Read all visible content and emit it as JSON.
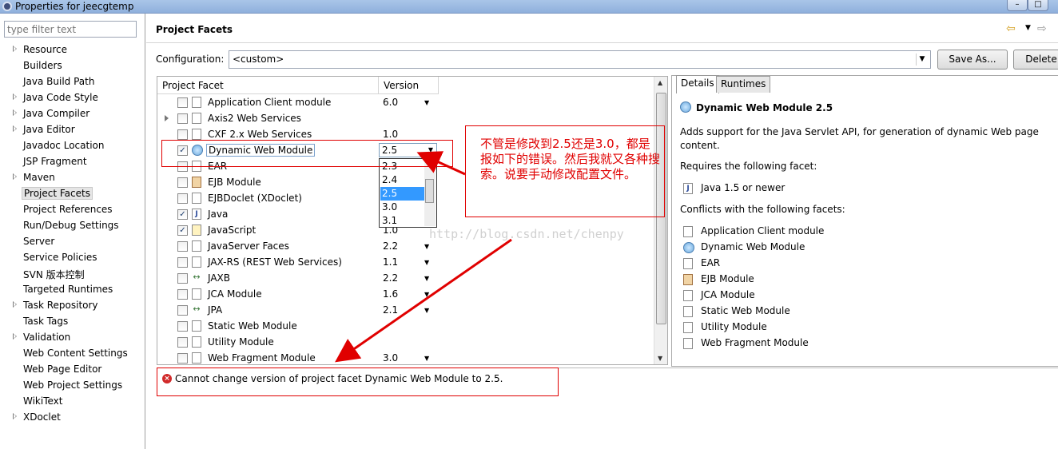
{
  "window": {
    "title": "Properties for jeecgtemp",
    "minimize": "–",
    "maximize": "□"
  },
  "filter": {
    "placeholder": "type filter text"
  },
  "sidebar": {
    "items": [
      {
        "label": "Resource",
        "expandable": true
      },
      {
        "label": "Builders",
        "expandable": false
      },
      {
        "label": "Java Build Path",
        "expandable": false
      },
      {
        "label": "Java Code Style",
        "expandable": true
      },
      {
        "label": "Java Compiler",
        "expandable": true
      },
      {
        "label": "Java Editor",
        "expandable": true
      },
      {
        "label": "Javadoc Location",
        "expandable": false
      },
      {
        "label": "JSP Fragment",
        "expandable": false
      },
      {
        "label": "Maven",
        "expandable": true
      },
      {
        "label": "Project Facets",
        "expandable": false,
        "selected": true
      },
      {
        "label": "Project References",
        "expandable": false
      },
      {
        "label": "Run/Debug Settings",
        "expandable": false
      },
      {
        "label": "Server",
        "expandable": false
      },
      {
        "label": "Service Policies",
        "expandable": false
      },
      {
        "label": "SVN 版本控制",
        "expandable": false
      },
      {
        "label": "Targeted Runtimes",
        "expandable": false
      },
      {
        "label": "Task Repository",
        "expandable": true
      },
      {
        "label": "Task Tags",
        "expandable": false
      },
      {
        "label": "Validation",
        "expandable": true
      },
      {
        "label": "Web Content Settings",
        "expandable": false
      },
      {
        "label": "Web Page Editor",
        "expandable": false
      },
      {
        "label": "Web Project Settings",
        "expandable": false
      },
      {
        "label": "WikiText",
        "expandable": false
      },
      {
        "label": "XDoclet",
        "expandable": true
      }
    ]
  },
  "header": {
    "title": "Project Facets",
    "back_icon": "⇦",
    "dropdown_icon": "▼",
    "forward_icon": "⇨"
  },
  "configuration": {
    "label": "Configuration:",
    "value": "<custom>",
    "save_as": "Save As...",
    "delete": "Delete"
  },
  "table": {
    "col_facet": "Project Facet",
    "col_version": "Version",
    "rows": [
      {
        "name": "Application Client module",
        "version": "6.0",
        "checked": false,
        "icon": "doc",
        "dd": true,
        "expand": false
      },
      {
        "name": "Axis2 Web Services",
        "version": "",
        "checked": false,
        "icon": "doc",
        "dd": false,
        "expand": true
      },
      {
        "name": "CXF 2.x Web Services",
        "version": "1.0",
        "checked": false,
        "icon": "doc",
        "dd": false,
        "expand": false
      },
      {
        "name": "Dynamic Web Module",
        "version": "",
        "checked": true,
        "icon": "globe",
        "dd": false,
        "expand": false,
        "selected": true
      },
      {
        "name": "EAR",
        "version": "",
        "checked": false,
        "icon": "doc",
        "dd": false,
        "expand": false
      },
      {
        "name": "EJB Module",
        "version": "",
        "checked": false,
        "icon": "bean",
        "dd": false,
        "expand": false
      },
      {
        "name": "EJBDoclet (XDoclet)",
        "version": "",
        "checked": false,
        "icon": "doc",
        "dd": false,
        "expand": false
      },
      {
        "name": "Java",
        "version": "",
        "checked": true,
        "icon": "java",
        "dd": false,
        "expand": false
      },
      {
        "name": "JavaScript",
        "version": "1.0",
        "checked": true,
        "icon": "jsx",
        "dd": false,
        "expand": false
      },
      {
        "name": "JavaServer Faces",
        "version": "2.2",
        "checked": false,
        "icon": "doc",
        "dd": true,
        "expand": false
      },
      {
        "name": "JAX-RS (REST Web Services)",
        "version": "1.1",
        "checked": false,
        "icon": "doc",
        "dd": true,
        "expand": false
      },
      {
        "name": "JAXB",
        "version": "2.2",
        "checked": false,
        "icon": "arrowx",
        "dd": true,
        "expand": false
      },
      {
        "name": "JCA Module",
        "version": "1.6",
        "checked": false,
        "icon": "doc",
        "dd": true,
        "expand": false
      },
      {
        "name": "JPA",
        "version": "2.1",
        "checked": false,
        "icon": "arrowx",
        "dd": true,
        "expand": false
      },
      {
        "name": "Static Web Module",
        "version": "",
        "checked": false,
        "icon": "doc",
        "dd": false,
        "expand": false
      },
      {
        "name": "Utility Module",
        "version": "",
        "checked": false,
        "icon": "doc",
        "dd": false,
        "expand": false
      },
      {
        "name": "Web Fragment Module",
        "version": "3.0",
        "checked": false,
        "icon": "doc",
        "dd": true,
        "expand": false
      }
    ]
  },
  "version_dropdown": {
    "value": "2.5",
    "options": [
      {
        "label": "2.3",
        "selected": false
      },
      {
        "label": "2.4",
        "selected": false
      },
      {
        "label": "2.5",
        "selected": true
      },
      {
        "label": "3.0",
        "selected": false
      },
      {
        "label": "3.1",
        "selected": false
      }
    ]
  },
  "annotation": {
    "text": "不管是修改到2.5还是3.0，都是报如下的错误。然后我就又各种搜索。说要手动修改配置文件。",
    "color": "#e00000"
  },
  "watermark": "http://blog.csdn.net/chenpy",
  "details": {
    "tab_details": "Details",
    "tab_runtimes": "Runtimes",
    "title": "Dynamic Web Module 2.5",
    "description": "Adds support for the Java Servlet API, for generation of dynamic Web page content.",
    "requires_label": "Requires the following facet:",
    "requires": [
      {
        "name": "Java 1.5 or newer",
        "icon": "java"
      }
    ],
    "conflicts_label": "Conflicts with the following facets:",
    "conflicts": [
      {
        "name": "Application Client module",
        "icon": "doc"
      },
      {
        "name": "Dynamic Web Module",
        "icon": "globe"
      },
      {
        "name": "EAR",
        "icon": "doc"
      },
      {
        "name": "EJB Module",
        "icon": "bean"
      },
      {
        "name": "JCA Module",
        "icon": "doc"
      },
      {
        "name": "Static Web Module",
        "icon": "doc"
      },
      {
        "name": "Utility Module",
        "icon": "doc"
      },
      {
        "name": "Web Fragment Module",
        "icon": "doc"
      }
    ]
  },
  "error": {
    "message": "Cannot change version of project facet Dynamic Web Module to 2.5.",
    "icon": "error-icon"
  }
}
